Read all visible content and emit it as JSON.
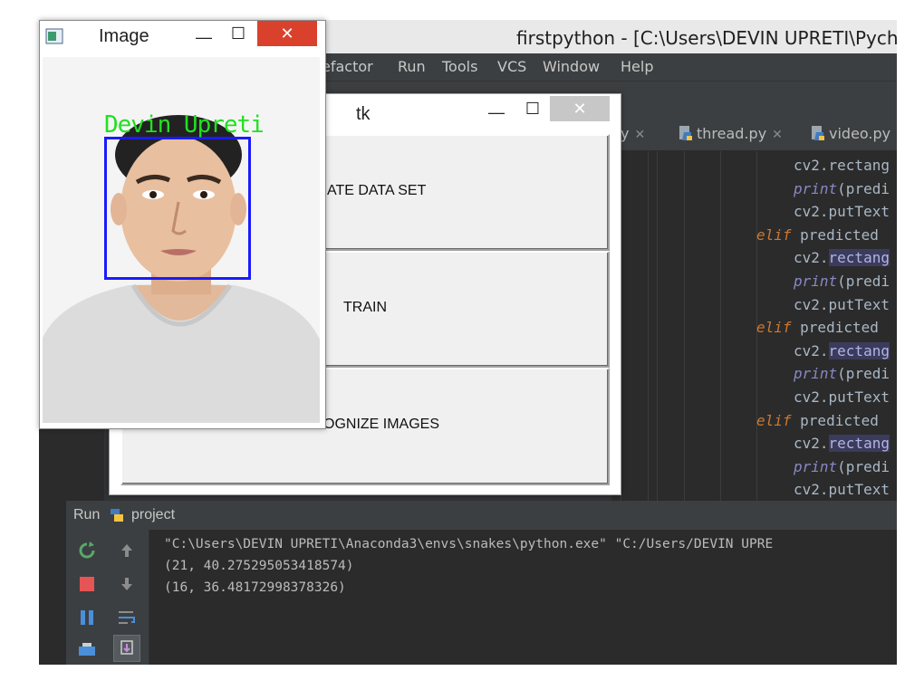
{
  "ide": {
    "title": "firstpython - [C:\\Users\\DEVIN UPRETI\\Pych",
    "menu": [
      "efactor",
      "Run",
      "Tools",
      "VCS",
      "Window",
      "Help"
    ],
    "tabs": [
      {
        "label": "y"
      },
      {
        "label": "thread.py"
      },
      {
        "label": "video.py"
      }
    ],
    "code_lines": [
      {
        "indent": 0,
        "segments": [
          {
            "cls": "",
            "text": "cv2.rectang"
          }
        ]
      },
      {
        "indent": 0,
        "segments": [
          {
            "cls": "bi",
            "text": "print"
          },
          {
            "cls": "",
            "text": "(predi"
          }
        ]
      },
      {
        "indent": 0,
        "segments": [
          {
            "cls": "",
            "text": "cv2.putText"
          }
        ]
      },
      {
        "indent": 1,
        "segments": [
          {
            "cls": "kw",
            "text": "elif"
          },
          {
            "cls": "",
            "text": " predicted"
          }
        ]
      },
      {
        "indent": 0,
        "segments": [
          {
            "cls": "",
            "text": "cv2."
          },
          {
            "cls": "hl",
            "text": "rectang"
          }
        ]
      },
      {
        "indent": 0,
        "segments": [
          {
            "cls": "bi",
            "text": "print"
          },
          {
            "cls": "",
            "text": "(predi"
          }
        ]
      },
      {
        "indent": 0,
        "segments": [
          {
            "cls": "",
            "text": "cv2.putText"
          }
        ]
      },
      {
        "indent": 1,
        "segments": [
          {
            "cls": "kw",
            "text": "elif"
          },
          {
            "cls": "",
            "text": " predicted"
          }
        ]
      },
      {
        "indent": 0,
        "segments": [
          {
            "cls": "",
            "text": "cv2."
          },
          {
            "cls": "hl",
            "text": "rectang"
          }
        ]
      },
      {
        "indent": 0,
        "segments": [
          {
            "cls": "bi",
            "text": "print"
          },
          {
            "cls": "",
            "text": "(predi"
          }
        ]
      },
      {
        "indent": 0,
        "segments": [
          {
            "cls": "",
            "text": "cv2.putText"
          }
        ]
      },
      {
        "indent": 1,
        "segments": [
          {
            "cls": "kw",
            "text": "elif"
          },
          {
            "cls": "",
            "text": " predicted"
          }
        ]
      },
      {
        "indent": 0,
        "segments": [
          {
            "cls": "",
            "text": "cv2."
          },
          {
            "cls": "hl",
            "text": "rectang"
          }
        ]
      },
      {
        "indent": 0,
        "segments": [
          {
            "cls": "bi",
            "text": "print"
          },
          {
            "cls": "",
            "text": "(predi"
          }
        ]
      },
      {
        "indent": 0,
        "segments": [
          {
            "cls": "",
            "text": "cv2.putText"
          }
        ]
      }
    ],
    "run_panel": {
      "label": "Run",
      "project": "project",
      "console": [
        "\"C:\\Users\\DEVIN UPRETI\\Anaconda3\\envs\\snakes\\python.exe\" \"C:/Users/DEVIN UPRE",
        "(21, 40.275295053418574)",
        "(16, 36.48172998378326)"
      ]
    }
  },
  "tk_window": {
    "title": "tk",
    "buttons": [
      {
        "label": "ATE DATA SET"
      },
      {
        "label": "TRAIN"
      },
      {
        "label": "OGNIZE IMAGES"
      }
    ]
  },
  "image_window": {
    "title": "Image",
    "face_label": "Devin Upreti"
  },
  "colors": {
    "face_box": "#1a1aff",
    "face_label": "#22e022",
    "close_button": "#d9412d"
  }
}
